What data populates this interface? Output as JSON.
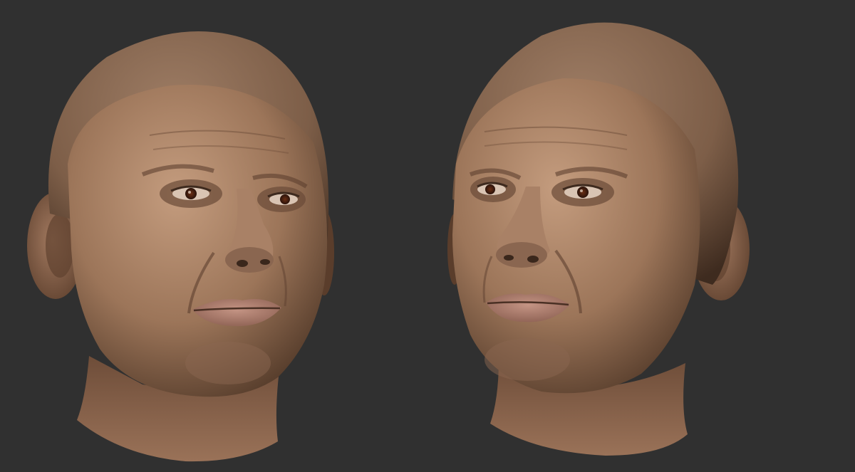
{
  "scene": {
    "background_color": "#303030",
    "skin_base_color": "#a07a5f",
    "skin_shadow_color": "#4e3626",
    "skin_highlight_color": "#c49c7e",
    "lip_color": "#a87567",
    "iris_color": "#5a2812",
    "heads": [
      {
        "name": "head-left-view",
        "facing": "three-quarter-right"
      },
      {
        "name": "head-right-view",
        "facing": "three-quarter-left"
      }
    ]
  }
}
